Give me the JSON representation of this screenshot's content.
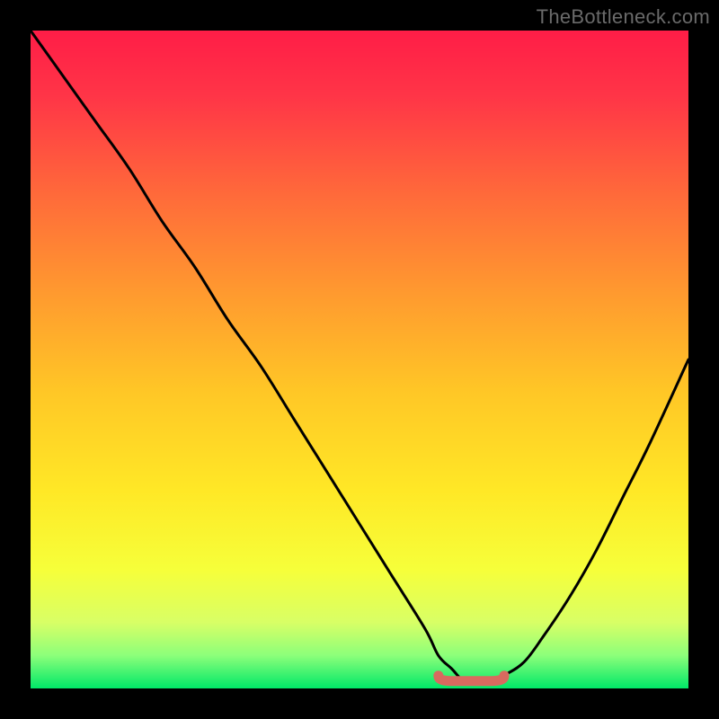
{
  "watermark": "TheBottleneck.com",
  "colors": {
    "frame": "#000000",
    "gradient_stops": [
      {
        "offset": 0.0,
        "color": "#ff1d47"
      },
      {
        "offset": 0.1,
        "color": "#ff3547"
      },
      {
        "offset": 0.25,
        "color": "#ff6a3a"
      },
      {
        "offset": 0.4,
        "color": "#ff9a2f"
      },
      {
        "offset": 0.55,
        "color": "#ffc726"
      },
      {
        "offset": 0.7,
        "color": "#ffe826"
      },
      {
        "offset": 0.82,
        "color": "#f6ff3a"
      },
      {
        "offset": 0.9,
        "color": "#d8ff66"
      },
      {
        "offset": 0.95,
        "color": "#8cff7a"
      },
      {
        "offset": 1.0,
        "color": "#00e868"
      }
    ],
    "curve": "#000000",
    "marker_fill": "#d96a5f",
    "marker_stroke": "#c24f46"
  },
  "chart_data": {
    "type": "line",
    "title": "",
    "xlabel": "",
    "ylabel": "",
    "xlim": [
      0,
      100
    ],
    "ylim": [
      0,
      100
    ],
    "series": [
      {
        "name": "bottleneck-curve",
        "x": [
          0,
          5,
          10,
          15,
          20,
          25,
          30,
          35,
          40,
          45,
          50,
          55,
          60,
          62,
          64,
          66,
          68,
          70,
          72,
          75,
          78,
          82,
          86,
          90,
          94,
          100
        ],
        "values": [
          100,
          93,
          86,
          79,
          71,
          64,
          56,
          49,
          41,
          33,
          25,
          17,
          9,
          5,
          3,
          1,
          1,
          1,
          2,
          4,
          8,
          14,
          21,
          29,
          37,
          50
        ]
      }
    ],
    "annotations": [
      {
        "name": "min-plateau-marker",
        "x_start": 62,
        "x_end": 72,
        "y": 1
      }
    ]
  }
}
